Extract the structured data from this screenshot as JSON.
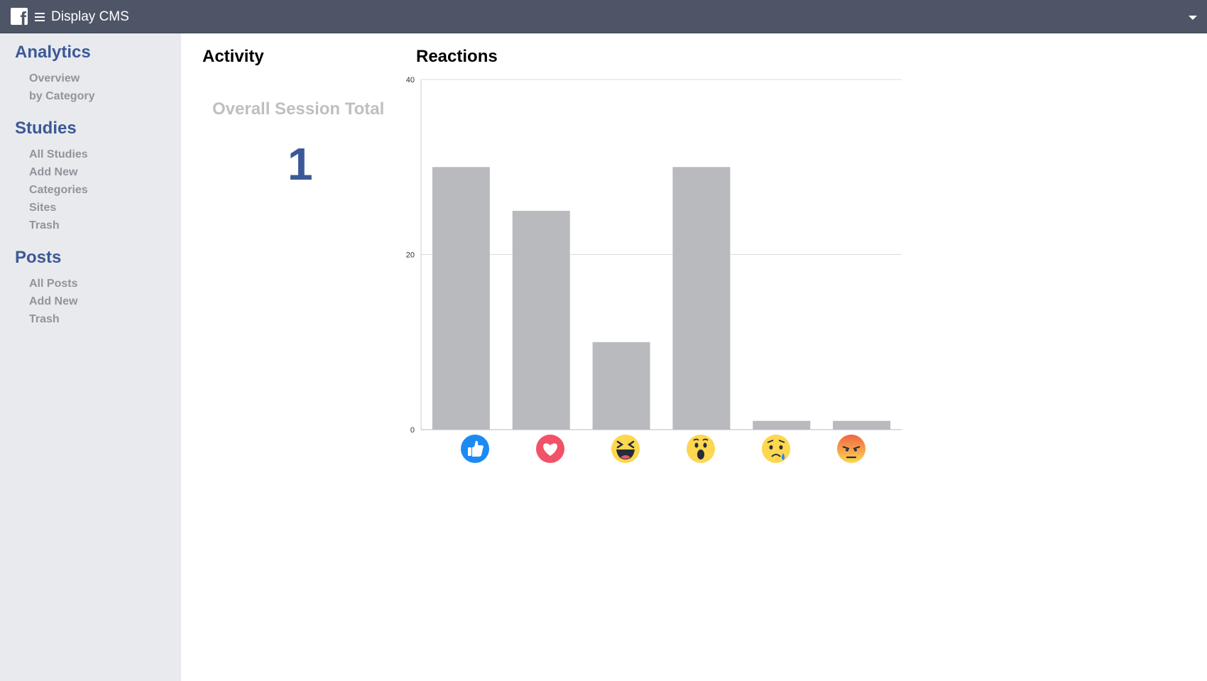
{
  "header": {
    "title": "Display CMS",
    "logo_icon": "facebook-logo-icon",
    "menu_icon": "hamburger-menu-icon",
    "dropdown_icon": "caret-down-icon",
    "background_color": "#4e5567"
  },
  "sidebar": {
    "sections": [
      {
        "heading": "Analytics",
        "items": [
          "Overview",
          "by Category"
        ]
      },
      {
        "heading": "Studies",
        "items": [
          "All Studies",
          "Add New",
          "Categories",
          "Sites",
          "Trash"
        ]
      },
      {
        "heading": "Posts",
        "items": [
          "All Posts",
          "Add New",
          "Trash"
        ]
      }
    ],
    "heading_color": "#3b5998",
    "item_color": "#90949c"
  },
  "activity": {
    "title": "Activity",
    "stat_label": "Overall Session Total",
    "stat_value": "1"
  },
  "reactions": {
    "title": "Reactions"
  },
  "chart_data": {
    "type": "bar",
    "title": "",
    "xlabel": "",
    "ylabel": "",
    "categories": [
      "like-icon",
      "love-icon",
      "haha-icon",
      "wow-icon",
      "sad-icon",
      "angry-icon"
    ],
    "values": [
      30,
      25,
      10,
      30,
      1,
      1
    ],
    "ylim": [
      0,
      40
    ],
    "yticks": [
      "0",
      "20",
      "40"
    ],
    "grid": true,
    "bar_color": "#b8babe",
    "icon_colors": {
      "like": "#1d8af3",
      "love": "#f25268",
      "yellow": "#fcd74f",
      "angry_top": "#f06545"
    }
  }
}
